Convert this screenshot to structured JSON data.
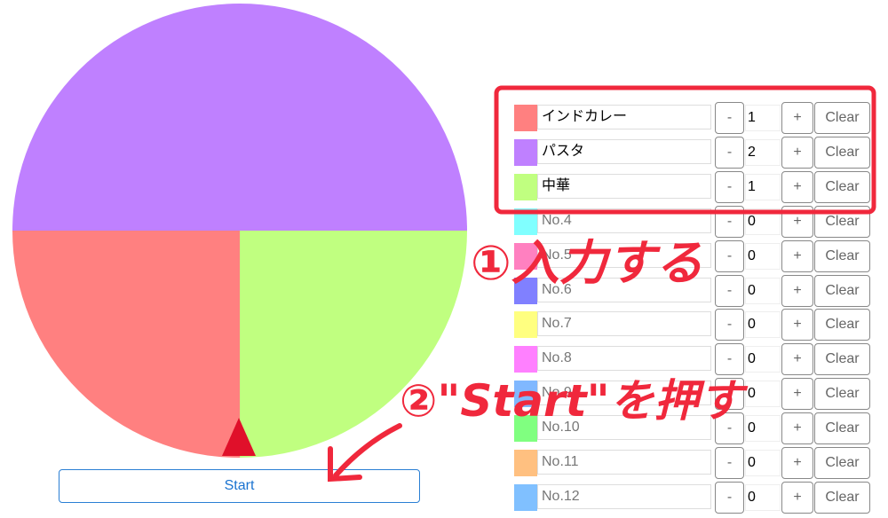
{
  "roulette": {
    "segments": [
      {
        "label": "インドカレー",
        "weight": 1,
        "color": "#ff8080"
      },
      {
        "label": "パスタ",
        "weight": 2,
        "color": "#bf80ff"
      },
      {
        "label": "中華",
        "weight": 1,
        "color": "#c0ff80"
      }
    ],
    "pointer_color": "#e0102a"
  },
  "start_label": "Start",
  "items": [
    {
      "name": "インドカレー",
      "placeholder": "No.1",
      "count": "1",
      "color": "#ff8080"
    },
    {
      "name": "パスタ",
      "placeholder": "No.2",
      "count": "2",
      "color": "#bf80ff"
    },
    {
      "name": "中華",
      "placeholder": "No.3",
      "count": "1",
      "color": "#c0ff80"
    },
    {
      "name": "",
      "placeholder": "No.4",
      "count": "0",
      "color": "#80ffff"
    },
    {
      "name": "",
      "placeholder": "No.5",
      "count": "0",
      "color": "#ff80c0"
    },
    {
      "name": "",
      "placeholder": "No.6",
      "count": "0",
      "color": "#8080ff"
    },
    {
      "name": "",
      "placeholder": "No.7",
      "count": "0",
      "color": "#ffff80"
    },
    {
      "name": "",
      "placeholder": "No.8",
      "count": "0",
      "color": "#ff80ff"
    },
    {
      "name": "",
      "placeholder": "No.9",
      "count": "0",
      "color": "#80b8ff"
    },
    {
      "name": "",
      "placeholder": "No.10",
      "count": "0",
      "color": "#80ff80"
    },
    {
      "name": "",
      "placeholder": "No.11",
      "count": "0",
      "color": "#ffc080"
    },
    {
      "name": "",
      "placeholder": "No.12",
      "count": "0",
      "color": "#80c0ff"
    }
  ],
  "buttons": {
    "minus": "-",
    "plus": "+",
    "clear": "Clear"
  },
  "annotations": {
    "step1": "①入力する",
    "step2": "②\"Start\"を押す",
    "color": "#f0283c"
  }
}
